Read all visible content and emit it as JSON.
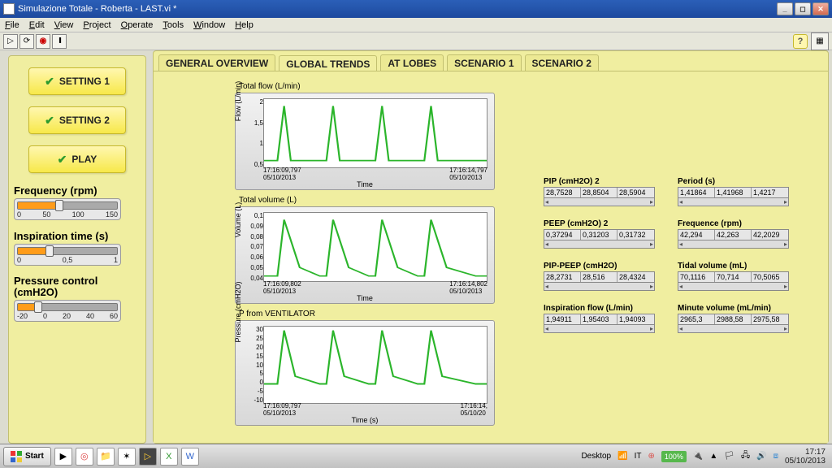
{
  "window": {
    "title": "Simulazione Totale - Roberta - LAST.vi *"
  },
  "menu": [
    "File",
    "Edit",
    "View",
    "Project",
    "Operate",
    "Tools",
    "Window",
    "Help"
  ],
  "side_buttons": {
    "s1": "SETTING 1",
    "s2": "SETTING 2",
    "play": "PLAY"
  },
  "sliders": {
    "freq": {
      "title": "Frequency (rpm)",
      "ticks": [
        "0",
        "50",
        "100",
        "150"
      ],
      "fill_pct": 40
    },
    "insp": {
      "title": "Inspiration time (s)",
      "ticks": [
        "0",
        "0,5",
        "1"
      ],
      "fill_pct": 30
    },
    "press": {
      "title": "Pressure control (cmH2O)",
      "ticks": [
        "-20",
        "0",
        "20",
        "40",
        "60"
      ],
      "fill_pct": 18
    }
  },
  "tabs": [
    "GENERAL OVERVIEW",
    "GLOBAL TRENDS",
    "AT LOBES",
    "SCENARIO 1",
    "SCENARIO 2"
  ],
  "active_tab": 1,
  "charts": {
    "flow": {
      "title": "Total flow (L/min)",
      "ylabel": "Flow (L/min)",
      "xlabel": "Time",
      "xstart": "17:16:09,797\n05/10/2013",
      "xend": "17:16:14,797\n05/10/2013",
      "yticks": [
        "2",
        "1,5",
        "1",
        "0,5"
      ]
    },
    "vol": {
      "title": "Total volume (L)",
      "ylabel": "Volume (L)",
      "xlabel": "Time",
      "xstart": "17:16:09,802\n05/10/2013",
      "xend": "17:16:14,802\n05/10/2013",
      "yticks": [
        "0,1",
        "0,09",
        "0,08",
        "0,07",
        "0,06",
        "0,05",
        "0,04"
      ]
    },
    "press": {
      "title": "P from VENTILATOR",
      "ylabel": "Pressure (cmH2O)",
      "xlabel": "Time (s)",
      "xstart": "17:16:09,797\n05/10/2013",
      "xend": "17:16:14,\n05/10/20",
      "yticks": [
        "30",
        "25",
        "20",
        "15",
        "10",
        "5",
        "0",
        "-5",
        "-10"
      ]
    }
  },
  "readouts": {
    "pip": {
      "label": "PIP (cmH2O) 2",
      "v": [
        "28,7528",
        "28,8504",
        "28,5904"
      ]
    },
    "peep": {
      "label": "PEEP (cmH2O) 2",
      "v": [
        "0,37294",
        "0,31203",
        "0,31732"
      ]
    },
    "diff": {
      "label": "PIP-PEEP (cmH2O)",
      "v": [
        "28,2731",
        "28,516",
        "28,4324"
      ]
    },
    "iflow": {
      "label": "Inspiration flow (L/min)",
      "v": [
        "1,94911",
        "1,95403",
        "1,94093"
      ]
    },
    "period": {
      "label": "Period (s)",
      "v": [
        "1,41864",
        "1,41968",
        "1,4217"
      ]
    },
    "freq": {
      "label": "Frequence (rpm)",
      "v": [
        "42,294",
        "42,263",
        "42,2029"
      ]
    },
    "tidal": {
      "label": "Tidal volume (mL)",
      "v": [
        "70,1116",
        "70,714",
        "70,5065"
      ]
    },
    "minvol": {
      "label": "Minute volume (mL/min)",
      "v": [
        "2965,3",
        "2988,58",
        "2975,58"
      ]
    }
  },
  "taskbar": {
    "start": "Start",
    "desktop": "Desktop",
    "lang": "IT",
    "battery": "100%",
    "time": "17:17",
    "date": "05/10/2013"
  },
  "chart_data": [
    {
      "type": "line",
      "title": "Total flow (L/min)",
      "ylabel": "Flow (L/min)",
      "xlabel": "Time",
      "x": [
        0,
        0.2,
        0.45,
        0.7,
        1.25,
        1.45,
        1.7,
        1.95,
        2.5,
        2.7,
        2.95,
        3.2,
        3.75,
        3.95,
        4.2,
        4.45,
        5.0
      ],
      "values": [
        0.5,
        0.5,
        1.95,
        0.5,
        0.5,
        0.5,
        1.95,
        0.5,
        0.5,
        0.5,
        1.95,
        0.5,
        0.5,
        0.5,
        1.95,
        0.5,
        0.5
      ],
      "ylim": [
        0.4,
        2.05
      ]
    },
    {
      "type": "line",
      "title": "Total volume (L)",
      "ylabel": "Volume (L)",
      "xlabel": "Time",
      "x": [
        0,
        0.2,
        0.45,
        0.9,
        1.25,
        1.45,
        1.7,
        2.15,
        2.5,
        2.7,
        2.95,
        3.4,
        3.75,
        3.95,
        4.2,
        4.65,
        5.0
      ],
      "values": [
        0.04,
        0.04,
        0.095,
        0.045,
        0.04,
        0.04,
        0.095,
        0.045,
        0.04,
        0.04,
        0.095,
        0.045,
        0.04,
        0.04,
        0.095,
        0.045,
        0.04
      ],
      "ylim": [
        0.035,
        0.1
      ]
    },
    {
      "type": "line",
      "title": "P from VENTILATOR",
      "ylabel": "Pressure (cmH2O)",
      "xlabel": "Time (s)",
      "x": [
        0,
        0.2,
        0.45,
        0.8,
        1.25,
        1.45,
        1.7,
        2.05,
        2.5,
        2.7,
        2.95,
        3.3,
        3.75,
        3.95,
        4.2,
        4.55,
        5.0
      ],
      "values": [
        0,
        0,
        28.7,
        2,
        0,
        0,
        28.8,
        2,
        0,
        0,
        28.6,
        2,
        0,
        0,
        28.7,
        2,
        0
      ],
      "ylim": [
        -10,
        30
      ]
    }
  ]
}
